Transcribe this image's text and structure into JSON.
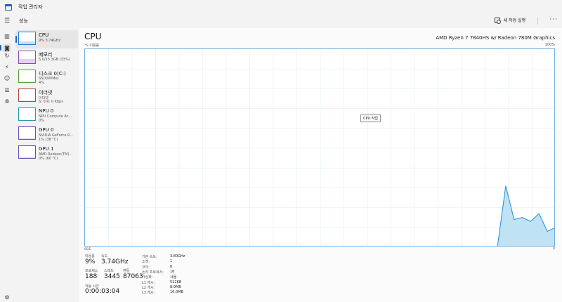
{
  "window": {
    "title": "작업 관리자"
  },
  "header": {
    "page_title": "성능",
    "run_task_label": "새 작업 실행",
    "more_label": "···"
  },
  "sidebar": {
    "nav_icon": "hamburger-icon",
    "items": [
      {
        "icon": "processes-icon",
        "glyph": "▥"
      },
      {
        "icon": "performance-icon",
        "glyph": "◙",
        "active": true
      },
      {
        "icon": "app-history-icon",
        "glyph": "↻"
      },
      {
        "icon": "startup-apps-icon",
        "glyph": "⚡"
      },
      {
        "icon": "users-icon",
        "glyph": "☺"
      },
      {
        "icon": "details-icon",
        "glyph": "☰"
      },
      {
        "icon": "services-icon",
        "glyph": "✲"
      }
    ],
    "settings_icon": "gear-icon"
  },
  "perf_list": [
    {
      "name": "CPU",
      "sub1": "9% 3.74GHz",
      "sub2": "",
      "kind": "cpu",
      "selected": true,
      "level": 0.25
    },
    {
      "name": "메모리",
      "sub1": "5.0/15.3GB (33%)",
      "sub2": "",
      "kind": "mem",
      "level": 0.33
    },
    {
      "name": "디스크 0(C:)",
      "sub1": "SSD(NVMe)",
      "sub2": "4%",
      "kind": "disk",
      "level": 0.04
    },
    {
      "name": "이더넷",
      "sub1": "이더넷",
      "sub2": "S: 0 R: 0 Kbps",
      "kind": "eth",
      "level": 0
    },
    {
      "name": "NPU 0",
      "sub1": "NPU Compute Ac...",
      "sub2": "0%",
      "kind": "npu",
      "level": 0
    },
    {
      "name": "GPU 0",
      "sub1": "NVIDIA GeForce R...",
      "sub2": "1% (38 °C)",
      "kind": "gpu",
      "level": 0.02
    },
    {
      "name": "GPU 1",
      "sub1": "AMD Radeon(TM)...",
      "sub2": "0% (60 °C)",
      "kind": "gpu",
      "level": 0.02
    }
  ],
  "main": {
    "heading": "CPU",
    "model": "AMD Ryzen 7 7840HS w/ Radeon 780M Graphics",
    "util_label": "% 이용률",
    "pct_label": "100%",
    "time_label": "60초",
    "zero_label": "0",
    "tooltip": "CPU 작업"
  },
  "stats": {
    "util_label": "이용률",
    "util_value": "9%",
    "speed_label": "속도",
    "speed_value": "3.74GHz",
    "proc_label": "프로세스",
    "proc_value": "188",
    "thread_label": "스레드",
    "thread_value": "3445",
    "handle_label": "핸들",
    "handle_value": "87063",
    "uptime_label": "작동 시간",
    "uptime_value": "0:00:03:04"
  },
  "specs": [
    {
      "key": "기본 속도:",
      "value": "3.80GHz"
    },
    {
      "key": "소켓:",
      "value": "1"
    },
    {
      "key": "코어:",
      "value": "8"
    },
    {
      "key": "논리 프로세서:",
      "value": "16"
    },
    {
      "key": "가상화:",
      "value": "사용"
    },
    {
      "key": "L1 캐시:",
      "value": "512KB"
    },
    {
      "key": "L2 캐시:",
      "value": "8.0MB"
    },
    {
      "key": "L3 캐시:",
      "value": "16.0MB"
    }
  ],
  "colors": {
    "accent": "#1f5fbf",
    "graph_line": "#1c8ed6",
    "graph_fill": "#bfe3f5",
    "graph_grid": "#e3eef7"
  },
  "chart_data": {
    "type": "area",
    "ylim": [
      0,
      100
    ],
    "samples": [
      0,
      0,
      0,
      0,
      0,
      0,
      0,
      0,
      0,
      0,
      0,
      0,
      0,
      0,
      0,
      0,
      0,
      0,
      0,
      0,
      0,
      0,
      0,
      0,
      0,
      0,
      0,
      0,
      0,
      0,
      0,
      0,
      0,
      0,
      0,
      0,
      0,
      0,
      0,
      0,
      0,
      0,
      0,
      0,
      0,
      0,
      0,
      0,
      0,
      0,
      0,
      0,
      0,
      0,
      0,
      0,
      0,
      31,
      14,
      15,
      13,
      17,
      8,
      10
    ]
  }
}
